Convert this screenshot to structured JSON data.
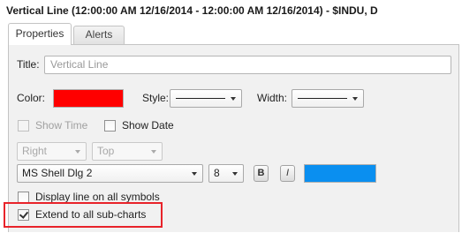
{
  "window": {
    "title": "Vertical Line (12:00:00 AM 12/16/2014 - 12:00:00 AM 12/16/2014) - $INDU, D"
  },
  "tabs": [
    {
      "label": "Properties",
      "active": true
    },
    {
      "label": "Alerts",
      "active": false
    }
  ],
  "form": {
    "title_label": "Title:",
    "title_placeholder": "Vertical Line",
    "color_label": "Color:",
    "color_value": "#ff0000",
    "style_label": "Style:",
    "width_label": "Width:",
    "show_time_label": "Show Time",
    "show_time_checked": false,
    "show_time_enabled": false,
    "show_date_label": "Show Date",
    "show_date_checked": false,
    "align_h": "Right",
    "align_v": "Top",
    "font_name": "MS Shell Dlg 2",
    "font_size": "8",
    "bold_label": "B",
    "italic_label": "I",
    "text_color": "#0a8ff0",
    "display_all_label": "Display line on all symbols",
    "display_all_checked": false,
    "extend_label": "Extend to all sub-charts",
    "extend_checked": true
  },
  "highlight_color": "#e8232a"
}
